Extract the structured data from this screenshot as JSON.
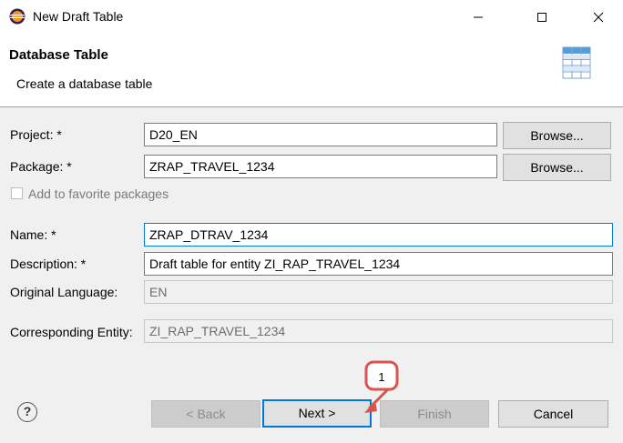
{
  "window": {
    "title": "New Draft Table",
    "controls": {
      "minimize": "—",
      "maximize": "☐",
      "close": "✕"
    }
  },
  "header": {
    "title": "Database Table",
    "subtitle": "Create a database table",
    "icon": "table-icon"
  },
  "form": {
    "project": {
      "label": "Project: *",
      "value": "D20_EN",
      "browse": "Browse..."
    },
    "package": {
      "label": "Package: *",
      "value": "ZRAP_TRAVEL_1234",
      "browse": "Browse..."
    },
    "favorite": {
      "label": "Add to favorite packages",
      "checked": false
    },
    "name": {
      "label": "Name: *",
      "value": "ZRAP_DTRAV_1234"
    },
    "description": {
      "label": "Description: *",
      "value": "Draft table for entity ZI_RAP_TRAVEL_1234"
    },
    "original_language": {
      "label": "Original Language:",
      "value": "EN"
    },
    "corresponding_entity": {
      "label": "Corresponding Entity:",
      "value": "ZI_RAP_TRAVEL_1234"
    }
  },
  "footer": {
    "help": "?",
    "back": "< Back",
    "next": "Next >",
    "finish": "Finish",
    "cancel": "Cancel"
  },
  "annotation": {
    "number": "1",
    "color": "#d9534f"
  },
  "colors": {
    "accent": "#0078d7",
    "dialog_bg": "#f0f0f0"
  }
}
